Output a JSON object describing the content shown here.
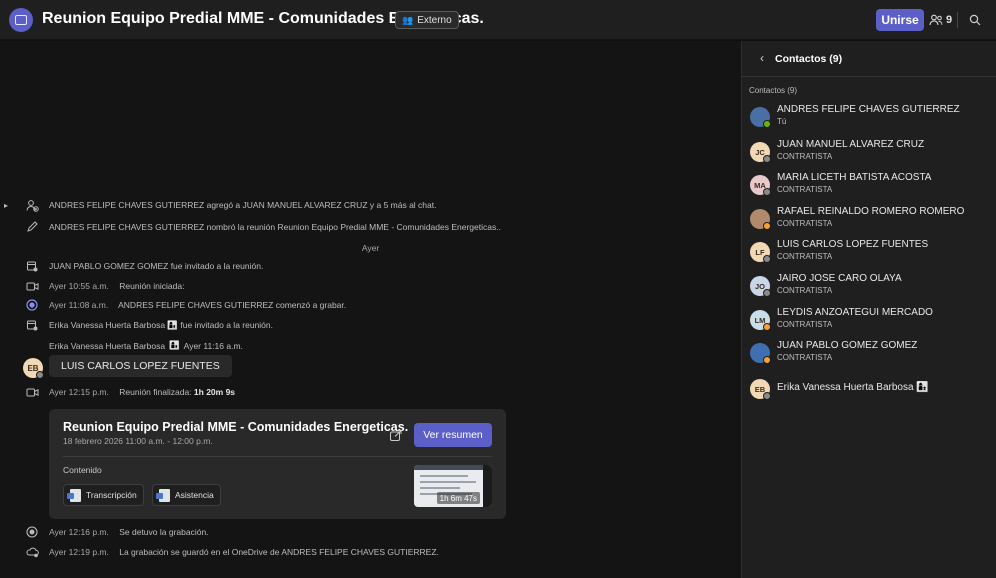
{
  "header": {
    "title": "Reunion Equipo Predial MME - Comunidades Energeticas.",
    "external_badge": "Externo",
    "join_label": "Unirse",
    "participants_count": "9"
  },
  "chat": {
    "system_rows": [
      {
        "icon": "add-person-icon",
        "text": "ANDRES FELIPE CHAVES GUTIERREZ agregó a JUAN MANUEL ALVAREZ CRUZ y a 5 más al chat."
      },
      {
        "icon": "pencil-icon",
        "text": "ANDRES FELIPE CHAVES GUTIERREZ nombró la reunión Reunion Equipo Predial MME - Comunidades Energeticas.."
      }
    ],
    "day_separator": "Ayer",
    "events": [
      {
        "icon": "calendar-invite-icon",
        "time": "",
        "text": "JUAN PABLO GOMEZ GOMEZ fue invitado a la reunión."
      },
      {
        "icon": "video-icon",
        "time": "Ayer 10:55 a.m.",
        "text": "Reunión iniciada:"
      },
      {
        "icon": "record-icon",
        "time": "Ayer 11:08 a.m.",
        "text": "ANDRES FELIPE CHAVES GUTIERREZ comenzó a grabar."
      },
      {
        "icon": "calendar-invite-icon",
        "time": "",
        "text": "Erika Vanessa Huerta Barbosa 👩‍👦 fue invitado a la reunión."
      }
    ],
    "message": {
      "author": "Erika Vanessa Huerta Barbosa",
      "author_initials": "EB",
      "time": "Ayer 11:16 a.m.",
      "body": "LUIS CARLOS LOPEZ FUENTES"
    },
    "meeting_ended": {
      "time": "Ayer 12:15 p.m.",
      "text": "Reunión finalizada:",
      "duration": "1h 20m 9s"
    },
    "card": {
      "title": "Reunion Equipo Predial MME - Comunidades Energeticas.",
      "date": "18 febrero 2026 11:00 a.m. - 12:00 p.m.",
      "summary_button": "Ver resumen",
      "content_label": "Contenido",
      "chips": [
        "Transcripción",
        "Asistencia"
      ],
      "video_duration": "1h 6m 47s"
    },
    "bottom_events": [
      {
        "icon": "record-stop-icon",
        "time": "Ayer 12:16 p.m.",
        "text": "Se detuvo la grabación."
      },
      {
        "icon": "cloud-save-icon",
        "time": "Ayer 12:19 p.m.",
        "text": "La grabación se guardó en el OneDrive de ANDRES FELIPE CHAVES GUTIERREZ."
      }
    ]
  },
  "panel": {
    "title": "Contactos (9)",
    "section_label": "Contactos (9)",
    "contacts": [
      {
        "name": "ANDRES FELIPE CHAVES GUTIERREZ",
        "role": "Tú",
        "initials": "",
        "avatar_color": "#4a6fa5",
        "status": "#6bb700"
      },
      {
        "name": "JUAN MANUEL ALVAREZ CRUZ",
        "role": "CONTRATISTA",
        "initials": "JC",
        "avatar_color": "#f2d9b5",
        "status": "#8a8a8a"
      },
      {
        "name": "MARIA LICETH BATISTA ACOSTA",
        "role": "CONTRATISTA",
        "initials": "MA",
        "avatar_color": "#e8c9c9",
        "status": "#8a8a8a"
      },
      {
        "name": "RAFAEL REINALDO ROMERO ROMERO",
        "role": "CONTRATISTA",
        "initials": "",
        "avatar_color": "#b08a6a",
        "status": "#f8a133"
      },
      {
        "name": "LUIS CARLOS LOPEZ FUENTES",
        "role": "CONTRATISTA",
        "initials": "LF",
        "avatar_color": "#f2d9b5",
        "status": "#8a8a8a"
      },
      {
        "name": "JAIRO JOSE CARO OLAYA",
        "role": "CONTRATISTA",
        "initials": "JO",
        "avatar_color": "#c9d6e8",
        "status": "#8a8a8a"
      },
      {
        "name": "LEYDIS ANZOATEGUI MERCADO",
        "role": "CONTRATISTA",
        "initials": "LM",
        "avatar_color": "#c9dee8",
        "status": "#f8a133"
      },
      {
        "name": "JUAN PABLO GOMEZ GOMEZ",
        "role": "CONTRATISTA",
        "initials": "",
        "avatar_color": "#3f6fb0",
        "status": "#f8a133"
      },
      {
        "name": "Erika Vanessa Huerta Barbosa 👩‍👦",
        "role": "",
        "initials": "EB",
        "avatar_color": "#f2d9b5",
        "status": "#8a8a8a"
      }
    ]
  },
  "colors": {
    "accent": "#5b5fc7",
    "background": "#141414",
    "panel": "#1f1f1f"
  }
}
